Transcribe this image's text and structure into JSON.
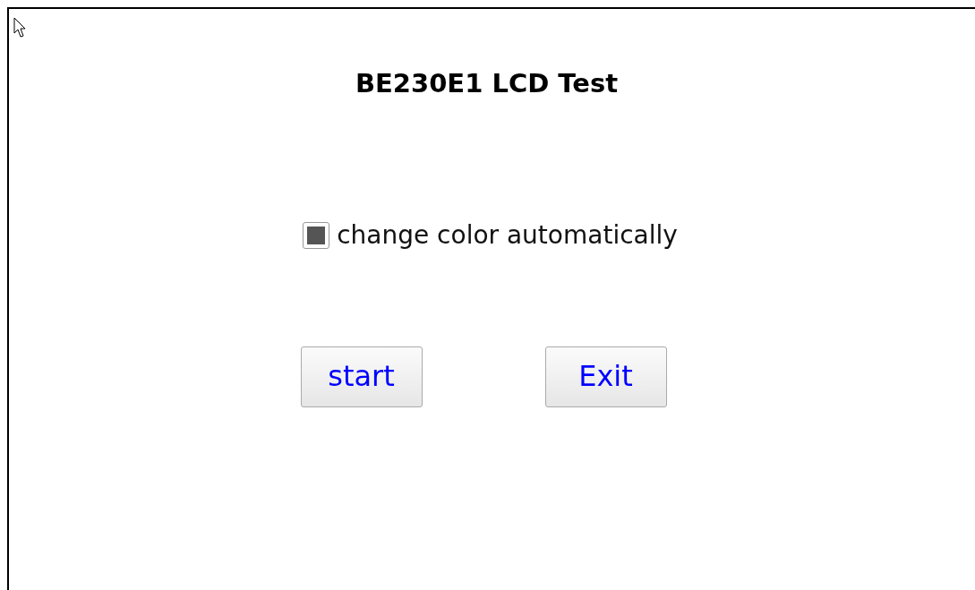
{
  "title": "BE230E1 LCD Test",
  "checkbox": {
    "label": "change color automatically",
    "checked": true
  },
  "buttons": [
    {
      "label": "start"
    },
    {
      "label": "Exit"
    }
  ]
}
